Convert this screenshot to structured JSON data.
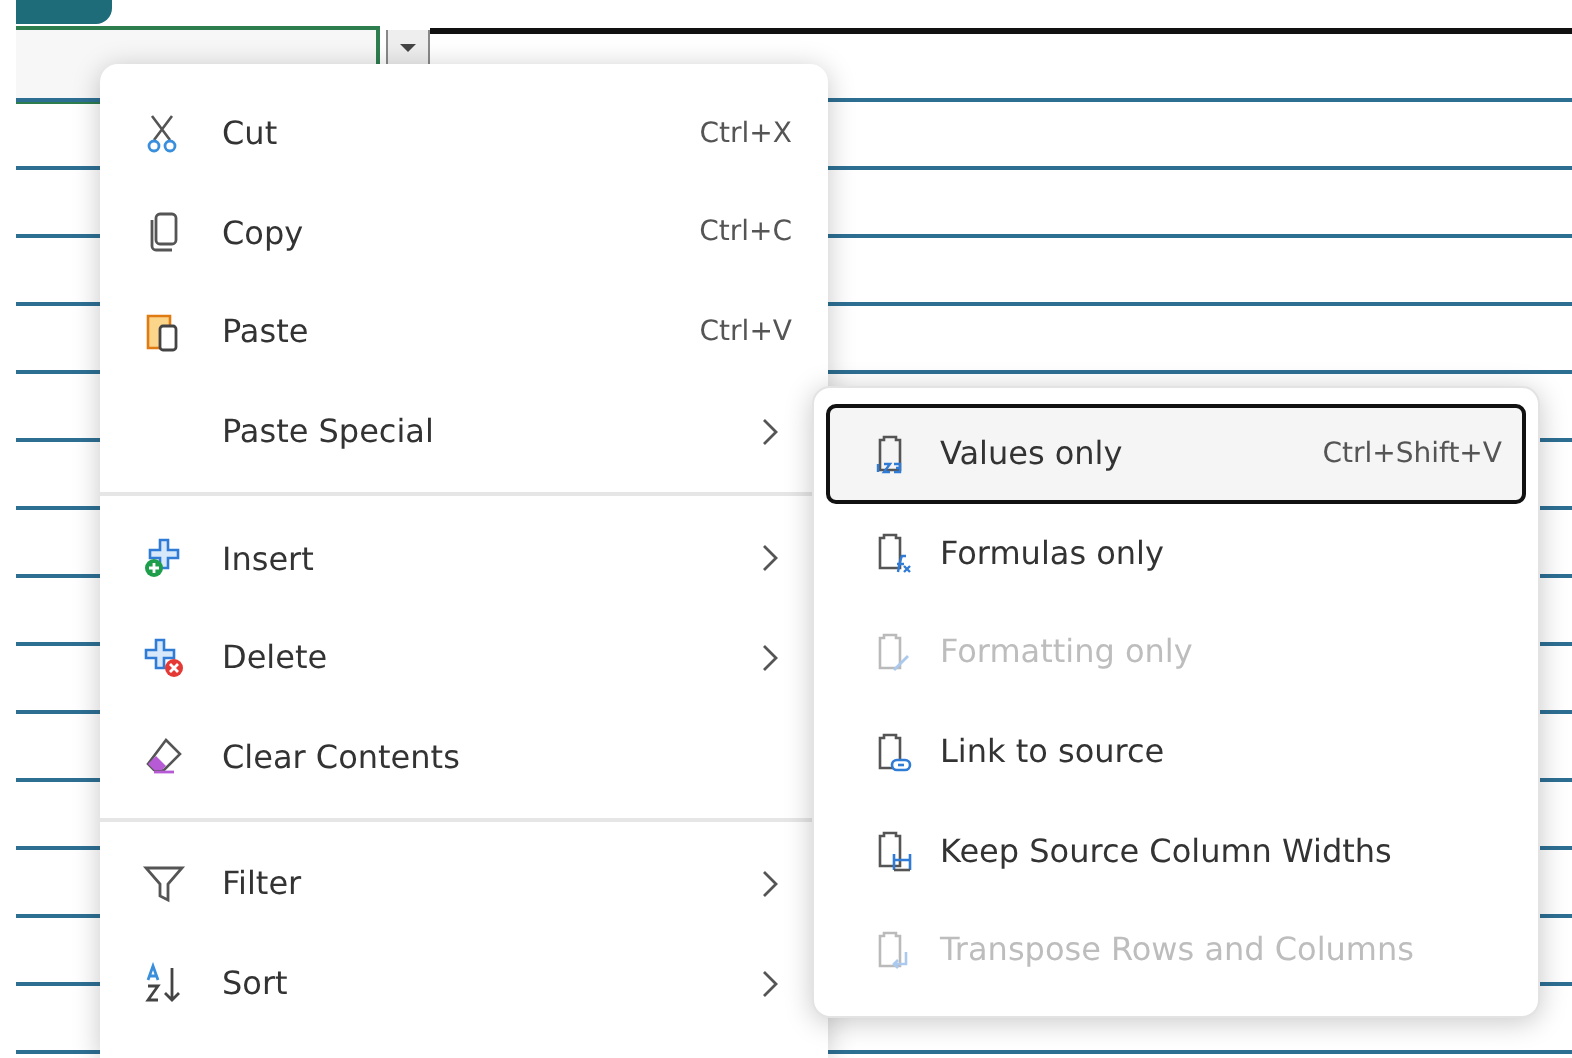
{
  "menu": {
    "groups": [
      [
        {
          "label": "Cut",
          "shortcut": "Ctrl+X",
          "submenu": false
        },
        {
          "label": "Copy",
          "shortcut": "Ctrl+C",
          "submenu": false
        },
        {
          "label": "Paste",
          "shortcut": "Ctrl+V",
          "submenu": false
        },
        {
          "label": "Paste Special",
          "submenu": true
        }
      ],
      [
        {
          "label": "Insert",
          "submenu": true
        },
        {
          "label": "Delete",
          "submenu": true
        },
        {
          "label": "Clear Contents",
          "submenu": false
        }
      ],
      [
        {
          "label": "Filter",
          "submenu": true
        },
        {
          "label": "Sort",
          "submenu": true
        }
      ]
    ]
  },
  "submenu": {
    "items": [
      {
        "label": "Values only",
        "shortcut": "Ctrl+Shift+V",
        "selected": true,
        "disabled": false
      },
      {
        "label": "Formulas only",
        "selected": false,
        "disabled": false
      },
      {
        "label": "Formatting only",
        "selected": false,
        "disabled": true
      },
      {
        "label": "Link to source",
        "selected": false,
        "disabled": false
      },
      {
        "label": "Keep Source Column Widths",
        "selected": false,
        "disabled": false
      },
      {
        "label": "Transpose Rows and Columns",
        "selected": false,
        "disabled": true
      }
    ]
  }
}
